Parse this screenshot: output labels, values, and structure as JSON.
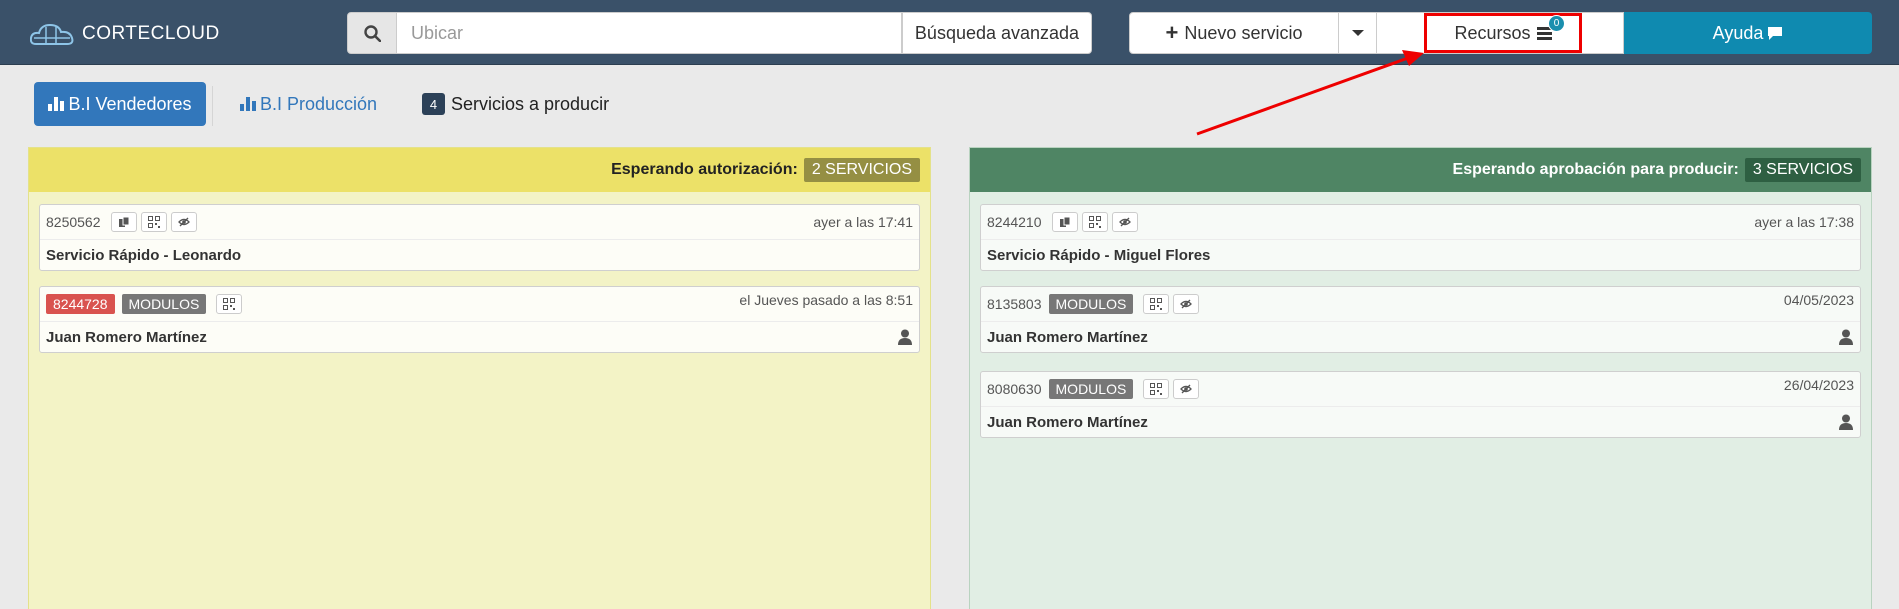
{
  "app": {
    "logo_text": "CORTECLOUD"
  },
  "search": {
    "placeholder": "Ubicar",
    "advanced_label": "Búsqueda avanzada"
  },
  "toolbar": {
    "new_service_label": "Nuevo servicio",
    "resources_label": "Recursos",
    "resources_badge": "0",
    "help_label": "Ayuda"
  },
  "tabs": {
    "sellers_label": "B.I Vendedores",
    "production_label": "B.I Producción",
    "to_produce_count": "4",
    "to_produce_label": "Servicios a producir"
  },
  "panels": {
    "left": {
      "title": "Esperando autorización:",
      "count": "2 SERVICIOS",
      "cards": [
        {
          "id": "8250562",
          "date": "ayer a las 17:41",
          "name": "Servicio Rápido - Leonardo"
        },
        {
          "id": "8244728",
          "tag": "MODULOS",
          "date": "el Jueves pasado a las 8:51",
          "name": "Juan Romero Martínez"
        }
      ]
    },
    "right": {
      "title": "Esperando aprobación para producir:",
      "count": "3 SERVICIOS",
      "cards": [
        {
          "id": "8244210",
          "date": "ayer a las 17:38",
          "name": "Servicio Rápido - Miguel Flores"
        },
        {
          "id": "8135803",
          "tag": "MODULOS",
          "date": "04/05/2023",
          "name": "Juan Romero Martínez"
        },
        {
          "id": "8080630",
          "tag": "MODULOS",
          "date": "26/04/2023",
          "name": "Juan Romero Martínez"
        }
      ]
    }
  },
  "colors": {
    "navbar": "#3a5169",
    "accent_blue": "#3277bb",
    "help_button": "#0f8ab0",
    "highlight_box": "#e00000",
    "left_panel_header": "#ece168",
    "right_panel_header": "#4f8564",
    "id_badge_red": "#d9534f"
  },
  "icons": [
    "search-icon",
    "plus-icon",
    "chevron-down-icon",
    "menu-icon",
    "chat-bubble-icon",
    "bar-chart-icon",
    "copy-icon",
    "qr-code-icon",
    "hidden-eye-icon",
    "user-icon",
    "cloud-logo-icon"
  ]
}
